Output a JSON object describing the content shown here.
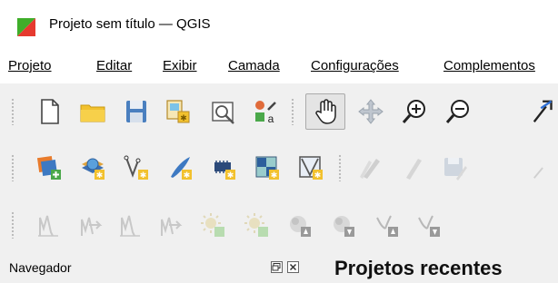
{
  "window": {
    "title": "Projeto sem título — QGIS",
    "app_icon": "qgis-logo-icon"
  },
  "menubar": {
    "items": [
      {
        "label": "Projeto",
        "mnemonic_index": 0
      },
      {
        "label": "Editar",
        "mnemonic_index": 0
      },
      {
        "label": "Exibir",
        "mnemonic_index": 0
      },
      {
        "label": "Camada",
        "mnemonic_index": 0
      },
      {
        "label": "Configurações",
        "mnemonic_index": 0
      },
      {
        "label": "Complementos",
        "mnemonic_index": 0
      }
    ]
  },
  "toolbars": {
    "project": [
      "new-project-icon",
      "open-project-icon",
      "save-project-icon",
      "print-layout-icon",
      "layout-manager-icon",
      "style-manager-icon"
    ],
    "navigation": [
      "pan-map-icon",
      "pan-to-selection-icon",
      "zoom-in-icon",
      "zoom-out-icon",
      "zoom-full-icon"
    ],
    "data_source": [
      "add-layer-icon",
      "add-wms-icon",
      "new-shapefile-icon",
      "new-gpx-icon",
      "new-virtual-layer-icon",
      "new-temp-layer-icon",
      "new-mesh-icon"
    ],
    "digitizing": [
      "current-edits-icon",
      "toggle-editing-icon",
      "save-layer-edits-icon",
      "digitize-icon"
    ],
    "advanced": [
      "add-line-icon",
      "add-line-vertices-icon",
      "add-polyline-icon",
      "add-polyline-vertices-icon",
      "light-add-icon",
      "light-vertices-icon",
      "node-add-icon",
      "node-remove-icon",
      "curve-add-icon",
      "curve-remove-icon"
    ]
  },
  "panels": {
    "browser": {
      "title": "Navegador",
      "float_icon": "dock-float-icon",
      "close_icon": "dock-close-icon"
    }
  },
  "welcome": {
    "recent_projects_title": "Projetos recentes"
  },
  "colors": {
    "titlebar_bg": "#ffffff",
    "toolbar_bg": "#f0f0f0",
    "folder_yellow": "#f2c12e",
    "save_blue": "#4a7fbf"
  }
}
